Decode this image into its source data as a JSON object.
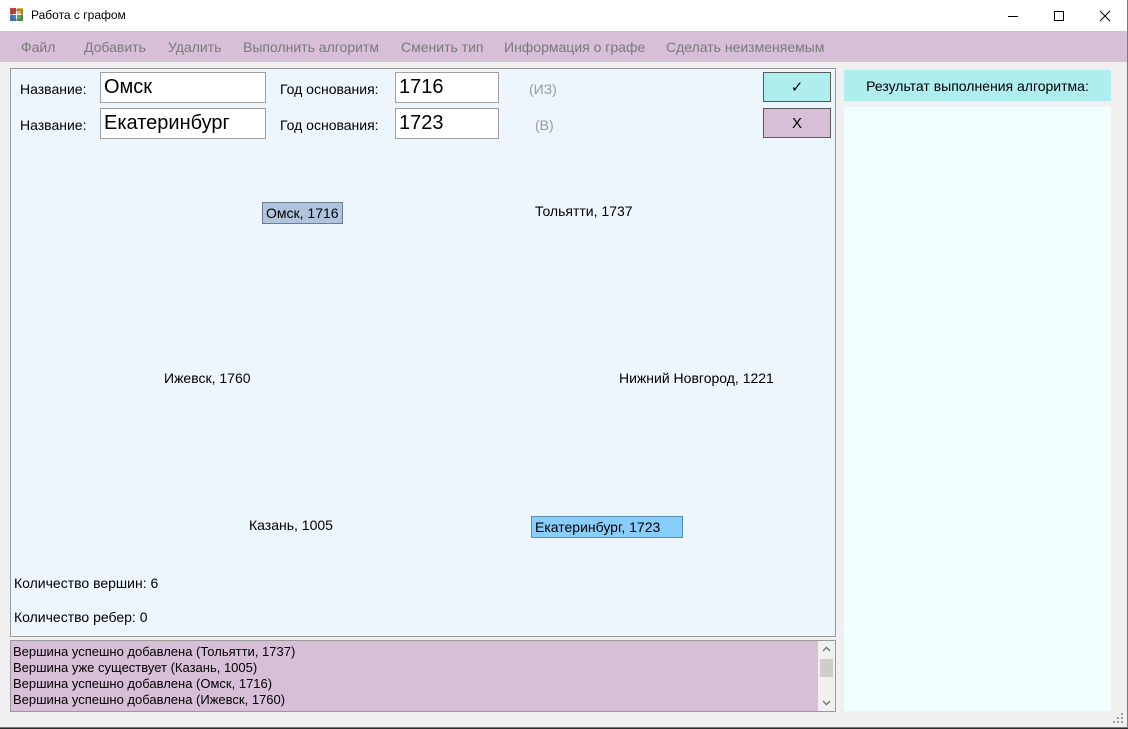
{
  "window": {
    "title": "Работа с графом"
  },
  "menu": {
    "items": [
      {
        "label": "Файл"
      },
      {
        "label": "Добавить"
      },
      {
        "label": "Удалить"
      },
      {
        "label": "Выполнить алгоритм"
      },
      {
        "label": "Сменить тип"
      },
      {
        "label": "Информация о графе"
      },
      {
        "label": "Сделать неизменяемым"
      }
    ]
  },
  "form": {
    "from": {
      "name_label": "Название:",
      "name_value": "Омск",
      "year_label": "Год основания:",
      "year_value": "1716",
      "hint": "(ИЗ)"
    },
    "to": {
      "name_label": "Название:",
      "name_value": "Екатеринбург",
      "year_label": "Год основания:",
      "year_value": "1723",
      "hint": "(В)"
    },
    "confirm_label": "✓",
    "cancel_label": "X"
  },
  "graph": {
    "nodes": [
      {
        "label": "Омск, 1716",
        "state": "from"
      },
      {
        "label": "Тольятти, 1737",
        "state": "none"
      },
      {
        "label": "Ижевск, 1760",
        "state": "none"
      },
      {
        "label": "Нижний Новгород, 1221",
        "state": "none"
      },
      {
        "label": "Казань, 1005",
        "state": "none"
      },
      {
        "label": "Екатеринбург, 1723",
        "state": "to"
      }
    ],
    "vertex_count": "Количество вершин: 6",
    "edge_count": "Количество ребер: 0"
  },
  "log": {
    "lines": [
      "Вершина успешно добавлена (Тольятти, 1737)",
      "Вершина уже существует (Казань, 1005)",
      "Вершина успешно добавлена (Омск, 1716)",
      "Вершина успешно добавлена (Ижевск, 1760)"
    ]
  },
  "result": {
    "header": "Результат выполнения алгоритма:"
  },
  "colors": {
    "menu_bg": "#d8bfd8",
    "canvas_bg": "#eef6fd",
    "from_node": "#b0c4de",
    "to_node": "#87cefa",
    "confirm_bg": "#aeeeee",
    "cancel_bg": "#d8bfd8",
    "result_bg": "#f0ffff"
  },
  "icons": {
    "app": "app-window-icon",
    "minimize": "minimize-icon",
    "maximize": "maximize-icon",
    "close": "close-icon"
  }
}
